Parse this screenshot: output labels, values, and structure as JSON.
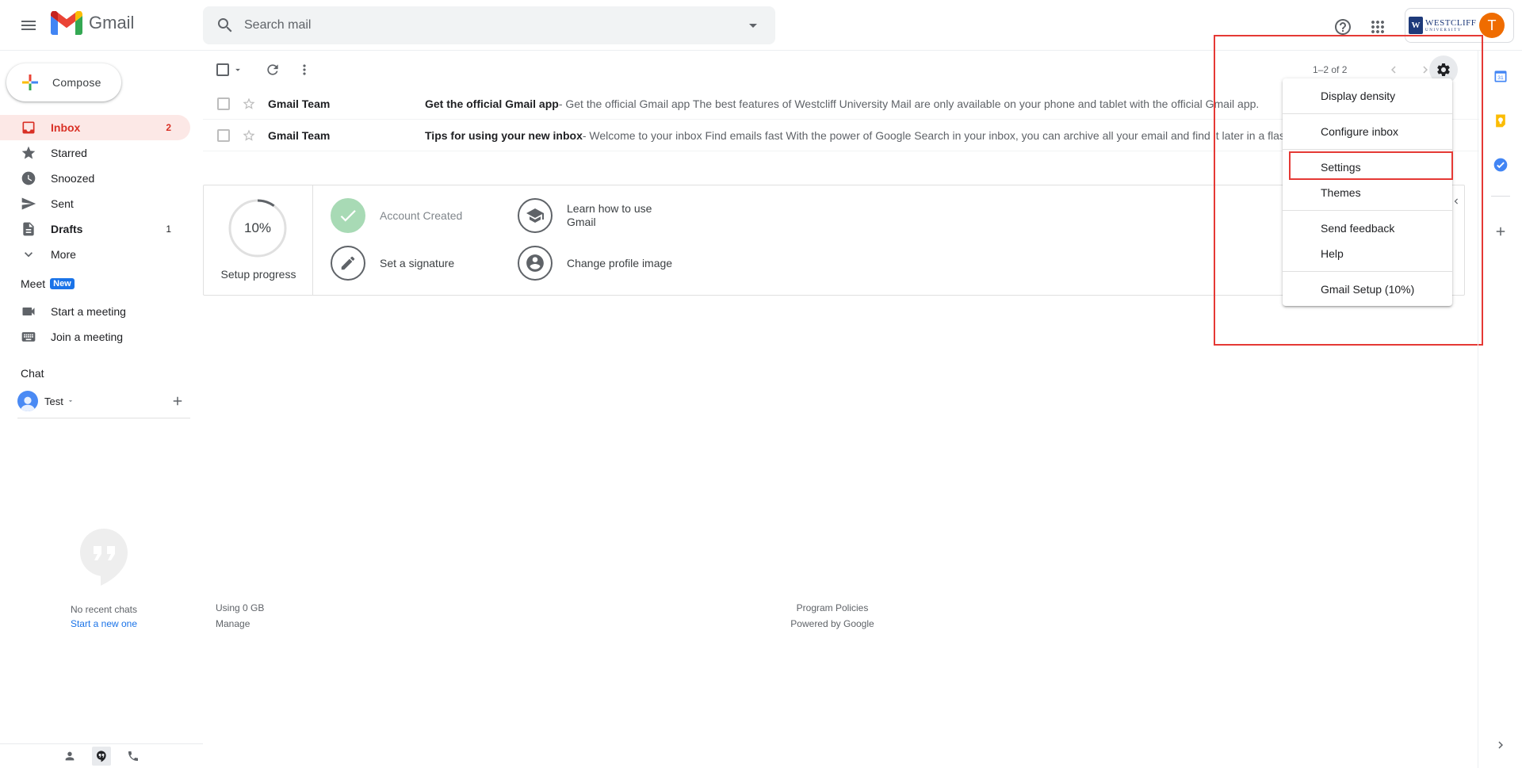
{
  "app": {
    "name": "Gmail"
  },
  "search": {
    "placeholder": "Search mail"
  },
  "account": {
    "avatar_letter": "T",
    "org_logo_name": "WESTCLIFF",
    "org_logo_sub": "UNIVERSITY",
    "org_logo_initial": "W"
  },
  "compose": {
    "label": "Compose"
  },
  "sidebar": {
    "items": [
      {
        "label": "Inbox",
        "count": "2",
        "icon": "inbox-icon"
      },
      {
        "label": "Starred",
        "count": "",
        "icon": "star-icon"
      },
      {
        "label": "Snoozed",
        "count": "",
        "icon": "clock-icon"
      },
      {
        "label": "Sent",
        "count": "",
        "icon": "send-icon"
      },
      {
        "label": "Drafts",
        "count": "1",
        "icon": "draft-icon"
      },
      {
        "label": "More",
        "count": "",
        "icon": "chevron-down-icon"
      }
    ]
  },
  "meet": {
    "title": "Meet",
    "badge": "New",
    "items": [
      {
        "label": "Start a meeting",
        "icon": "video-icon"
      },
      {
        "label": "Join a meeting",
        "icon": "keyboard-icon"
      }
    ]
  },
  "chat": {
    "title": "Chat",
    "user": "Test",
    "no_chats": "No recent chats",
    "start_new": "Start a new one"
  },
  "toolbar": {
    "pager": "1–2 of 2"
  },
  "emails": [
    {
      "sender": "Gmail Team",
      "subject": "Get the official Gmail app",
      "snippet": " - Get the official Gmail app The best features of Westcliff University Mail are only available on your phone and tablet with the official Gmail app."
    },
    {
      "sender": "Gmail Team",
      "subject": "Tips for using your new inbox",
      "snippet": " - Welcome to your inbox Find emails fast With the power of Google Search in your inbox, you can archive all your email and find it later in a flash."
    }
  ],
  "setup": {
    "percent": "10%",
    "progress_value": 0.1,
    "label": "Setup progress",
    "tasks": [
      {
        "label": "Account Created",
        "done": true
      },
      {
        "label": "Learn how to use Gmail",
        "done": false
      },
      {
        "label": "Set a signature",
        "done": false
      },
      {
        "label": "Change profile image",
        "done": false
      }
    ]
  },
  "footer": {
    "storage": "Using 0 GB",
    "manage": "Manage",
    "policies": "Program Policies",
    "powered": "Powered by Google"
  },
  "settings_menu": {
    "items": [
      "Display density",
      "Configure inbox",
      "Settings",
      "Themes",
      "Send feedback",
      "Help",
      "Gmail Setup (10%)"
    ]
  },
  "colors": {
    "accent_red": "#d93025",
    "highlight": "#e53935",
    "meet_badge": "#1a73e8",
    "avatar": "#ef6c00"
  }
}
